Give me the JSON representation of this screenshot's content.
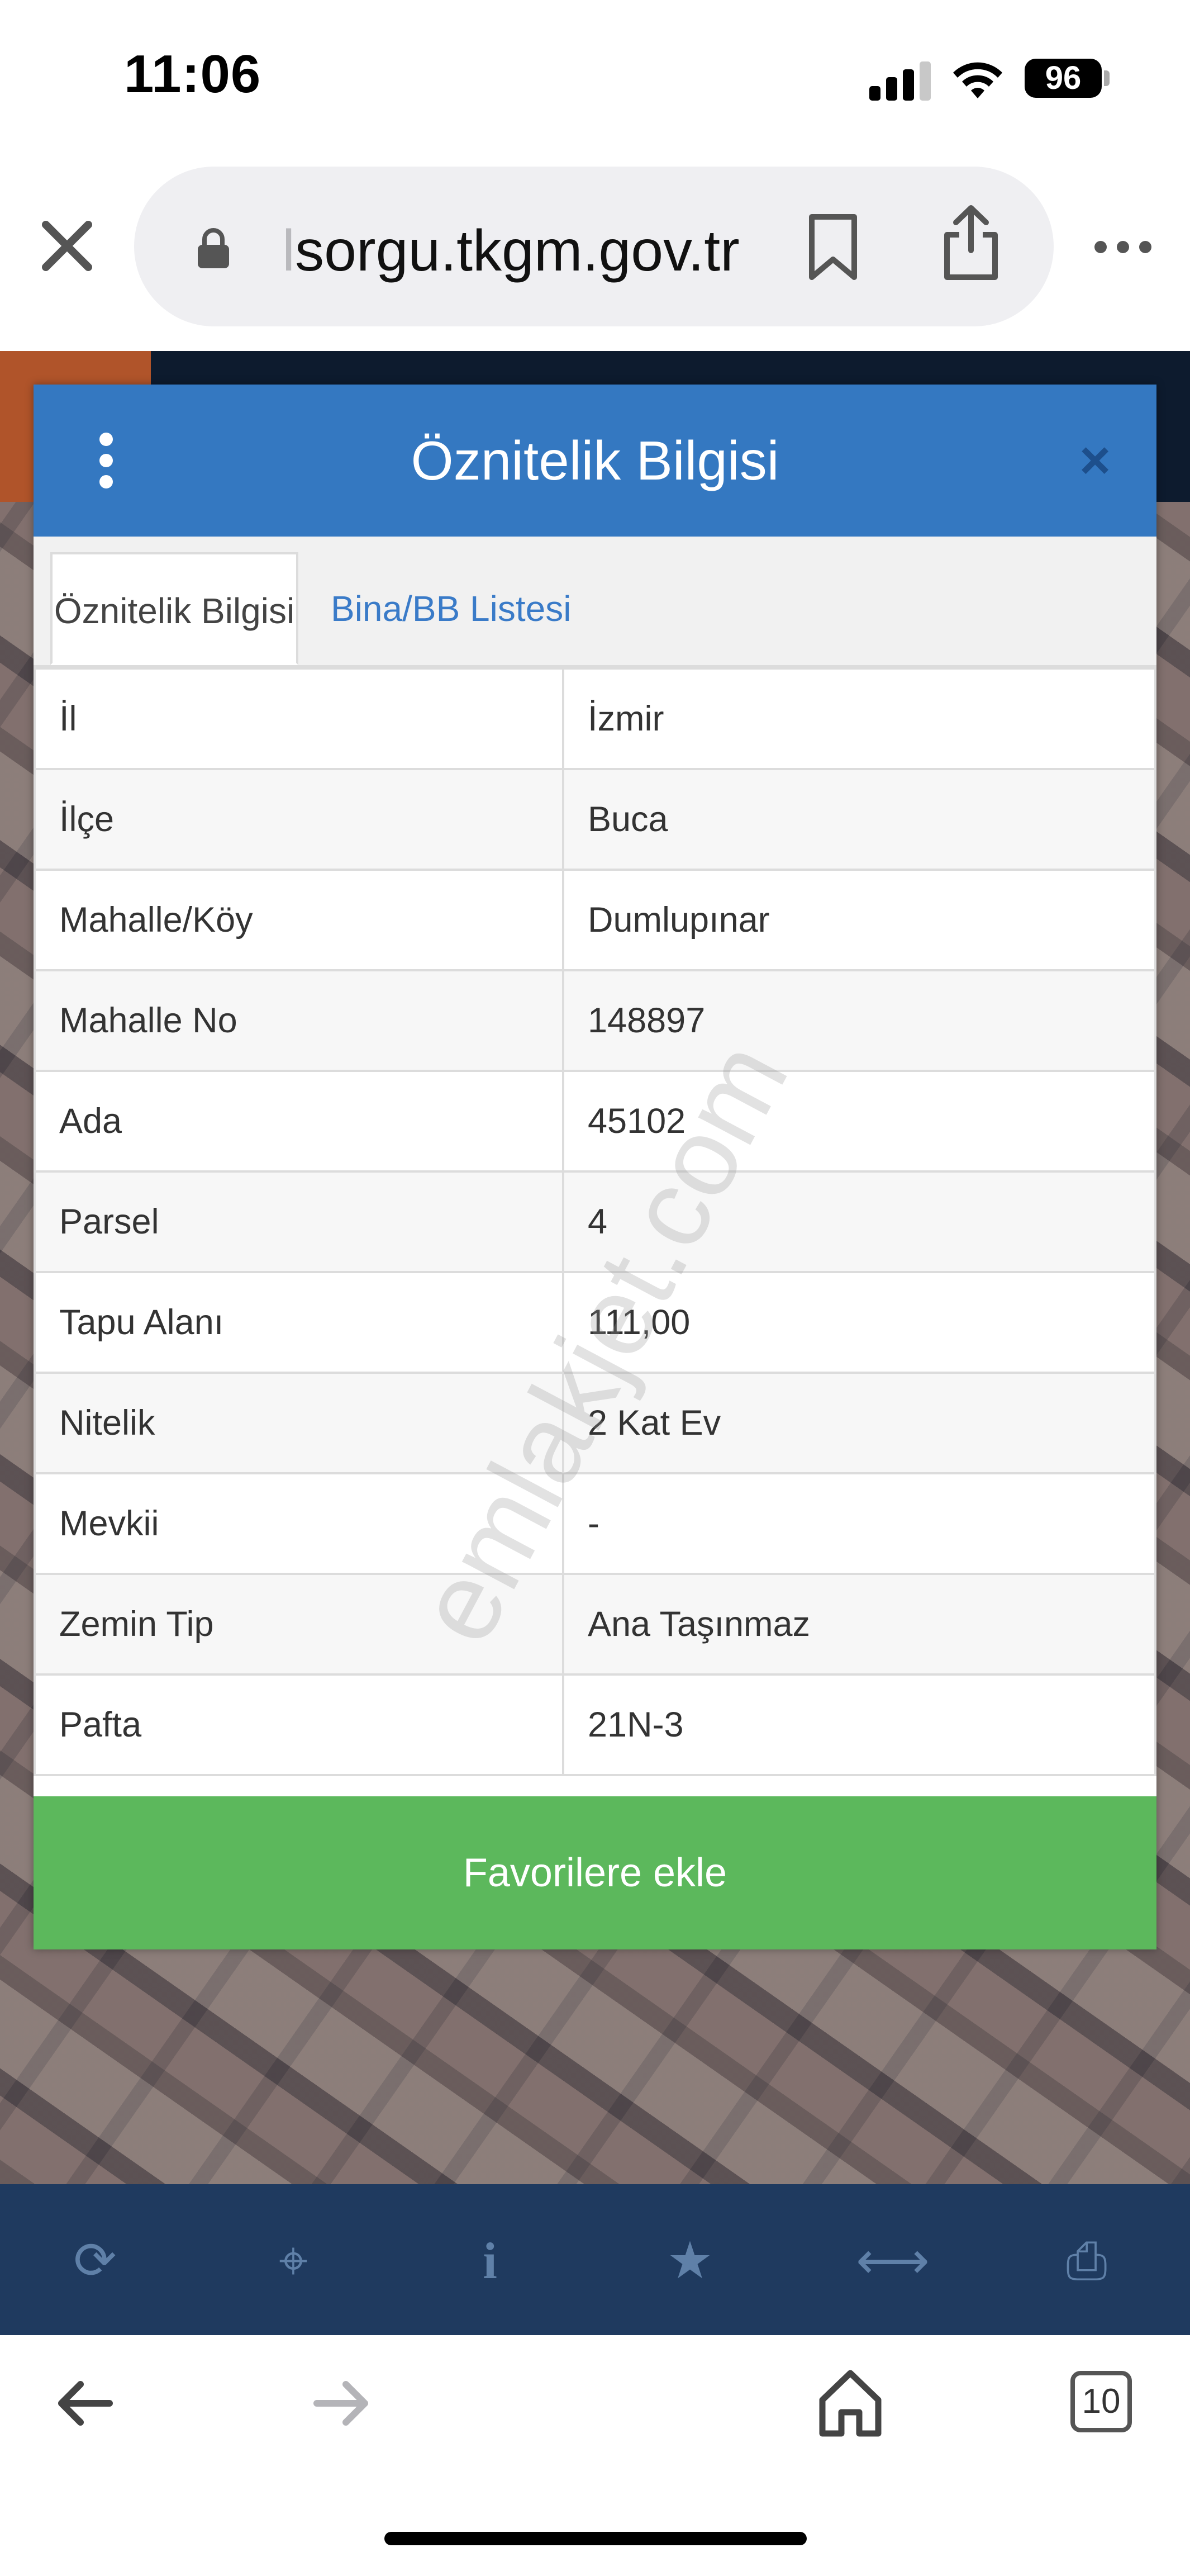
{
  "status_bar": {
    "time": "11:06",
    "battery": "96"
  },
  "browser": {
    "url_faded": "l",
    "url": "sorgu.tkgm.gov.tr",
    "tab_count": "10"
  },
  "panel": {
    "title": "Öznitelik Bilgisi",
    "close_glyph": "×",
    "tabs": [
      {
        "label": "Öznitelik Bilgisi",
        "active": true
      },
      {
        "label": "Bina/BB Listesi",
        "active": false
      }
    ],
    "rows": [
      {
        "key": "İl",
        "value": "İzmir"
      },
      {
        "key": "İlçe",
        "value": "Buca"
      },
      {
        "key": "Mahalle/Köy",
        "value": "Dumlupınar"
      },
      {
        "key": "Mahalle No",
        "value": "148897"
      },
      {
        "key": "Ada",
        "value": "45102"
      },
      {
        "key": "Parsel",
        "value": "4"
      },
      {
        "key": "Tapu Alanı",
        "value": "111,00"
      },
      {
        "key": "Nitelik",
        "value": "2 Kat Ev"
      },
      {
        "key": "Mevkii",
        "value": "-"
      },
      {
        "key": "Zemin Tip",
        "value": "Ana Taşınmaz"
      },
      {
        "key": "Pafta",
        "value": "21N-3"
      }
    ],
    "favorite_button": "Favorilere ekle"
  },
  "watermark": "emlakjet.com",
  "toolbar": {
    "icons": [
      {
        "name": "refresh-icon",
        "glyph": "⟳"
      },
      {
        "name": "crosshair-icon",
        "glyph": "⌖"
      },
      {
        "name": "info-icon",
        "glyph": "i"
      },
      {
        "name": "star-icon",
        "glyph": "★"
      },
      {
        "name": "measure-icon",
        "glyph": "⟷"
      },
      {
        "name": "print-icon",
        "glyph": "⎙"
      }
    ]
  },
  "colors": {
    "header_blue": "#3478c1",
    "tab_link_blue": "#3a7bc8",
    "favorite_green": "#5cb85c",
    "toolbar_navy": "#1f3a5f"
  }
}
